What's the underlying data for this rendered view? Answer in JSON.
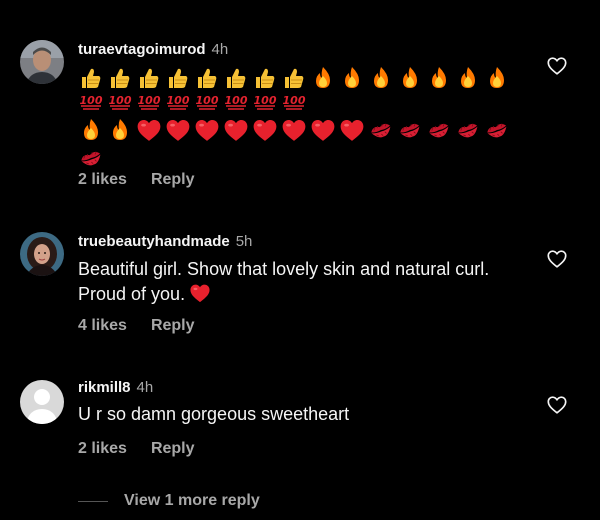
{
  "colors": {
    "background": "#000000",
    "primary_text": "#f5f5f5",
    "secondary_text": "#a8a8a8",
    "heart_emoji": "#e8212d",
    "fire_emoji": "#ff7a00",
    "thumbs_emoji": "#f6c135",
    "hundred_emoji": "#e3232f"
  },
  "comments": [
    {
      "username": "turaevtagoimurod",
      "time": "4h",
      "text": "",
      "emojis": [
        "thumbs-up",
        "thumbs-up",
        "thumbs-up",
        "thumbs-up",
        "thumbs-up",
        "thumbs-up",
        "thumbs-up",
        "thumbs-up",
        "fire",
        "fire",
        "fire",
        "fire",
        "fire",
        "fire",
        "fire",
        "fire",
        "fire",
        "red-heart",
        "red-heart",
        "red-heart",
        "red-heart",
        "red-heart",
        "red-heart",
        "red-heart",
        "red-heart",
        "kiss-mark",
        "kiss-mark",
        "kiss-mark",
        "kiss-mark",
        "kiss-mark",
        "kiss-mark"
      ],
      "likes": "2 likes",
      "reply": "Reply",
      "avatar_icon": "person-photo-avatar",
      "like_icon": "heart-outline-icon"
    },
    {
      "username": "truebeautyhandmade",
      "time": "5h",
      "text": "Beautiful girl.  Show that lovely skin and natural curl.  Proud of you.",
      "trailing_emoji": "red-heart",
      "likes": "4 likes",
      "reply": "Reply",
      "avatar_icon": "woman-photo-avatar",
      "like_icon": "heart-outline-icon"
    },
    {
      "username": "rikmill8",
      "time": "4h",
      "text": "U r so damn gorgeous sweetheart",
      "likes": "2 likes",
      "reply": "Reply",
      "avatar_icon": "default-avatar",
      "like_icon": "heart-outline-icon"
    }
  ],
  "view_more": "View 1 more reply"
}
